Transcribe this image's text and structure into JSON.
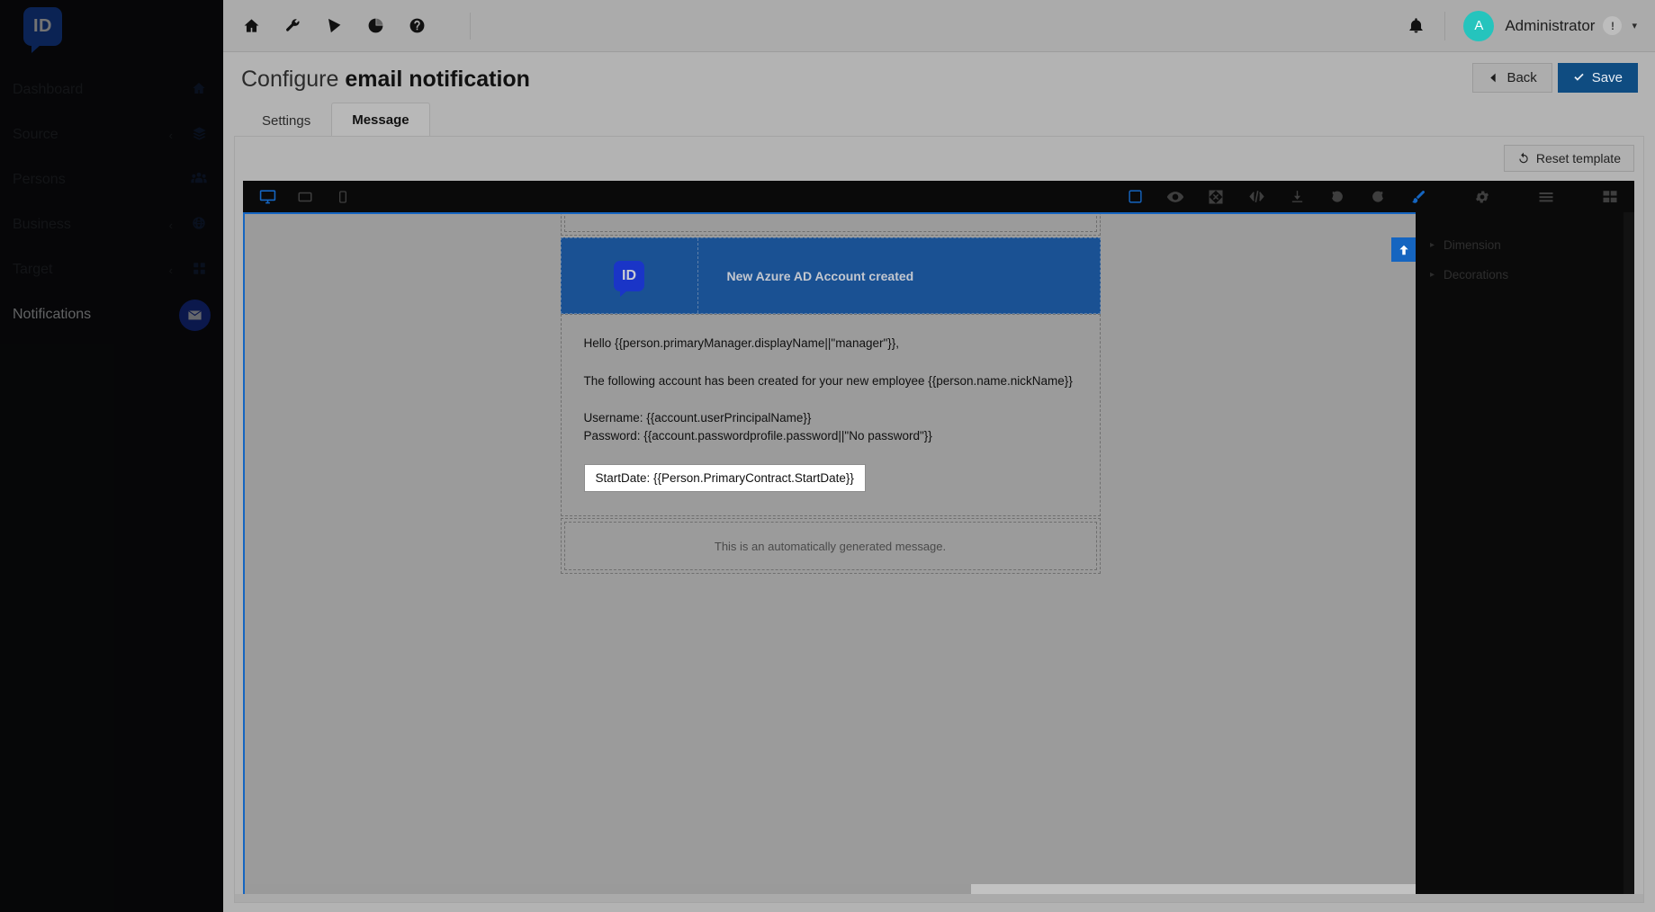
{
  "app": {
    "logo_text": "ID",
    "brand_blue": "#1a4fbb"
  },
  "sidebar": {
    "items": [
      {
        "label": "Dashboard",
        "icon": "home-icon",
        "caret": "",
        "active": false
      },
      {
        "label": "Source",
        "icon": "layers-icon",
        "caret": "‹",
        "active": false
      },
      {
        "label": "Persons",
        "icon": "users-icon",
        "caret": "",
        "active": false
      },
      {
        "label": "Business",
        "icon": "globe-icon",
        "caret": "‹",
        "active": false
      },
      {
        "label": "Target",
        "icon": "grid-icon",
        "caret": "‹",
        "active": false
      },
      {
        "label": "Notifications",
        "icon": "envelope-icon",
        "caret": "",
        "active": true
      }
    ]
  },
  "topbar": {
    "icons": [
      "home-icon",
      "wrench-icon",
      "project-diagram-icon",
      "pie-chart-icon",
      "question-circle-icon"
    ],
    "bell": "bell-icon",
    "avatar_initial": "A",
    "user_name": "Administrator",
    "user_badge": "!",
    "user_caret": "▾"
  },
  "page": {
    "title_prefix": "Configure ",
    "title_strong": "email notification",
    "back_label": "Back",
    "save_label": "Save",
    "reset_label": "Reset template"
  },
  "tabs": [
    {
      "label": "Settings",
      "active": false
    },
    {
      "label": "Message",
      "active": true
    }
  ],
  "editor": {
    "device_icons": [
      {
        "name": "desktop-icon",
        "active": true
      },
      {
        "name": "tablet-icon",
        "active": false
      },
      {
        "name": "mobile-icon",
        "active": false
      }
    ],
    "tool_icons": [
      {
        "name": "borders-toggle-icon",
        "active": true
      },
      {
        "name": "preview-eye-icon",
        "active": false
      },
      {
        "name": "fullscreen-icon",
        "active": false
      },
      {
        "name": "code-view-icon",
        "active": false
      },
      {
        "name": "import-download-icon",
        "active": false
      },
      {
        "name": "undo-icon",
        "active": false
      },
      {
        "name": "redo-icon",
        "active": false
      },
      {
        "name": "paint-brush-icon",
        "active": true
      },
      {
        "name": "gear-icon",
        "active": false
      },
      {
        "name": "layers-list-icon",
        "active": false
      },
      {
        "name": "blocks-grid-icon",
        "active": false
      }
    ],
    "move_up_icon": "arrow-up-icon"
  },
  "properties": {
    "sections": [
      {
        "label": "Dimension",
        "expanded": false
      },
      {
        "label": "Decorations",
        "expanded": false
      }
    ]
  },
  "email_template": {
    "logo_text": "ID",
    "header_title": "New Azure AD Account created",
    "body_lines": [
      "Hello {{person.primaryManager.displayName||\"manager\"}},",
      "The following account has been created for your new employee {{person.name.nickName}}",
      "Username: {{account.userPrincipalName}}",
      "Password: {{account.passwordprofile.password||\"No password\"}}"
    ],
    "selected_line": "StartDate: {{Person.PrimaryContract.StartDate}}",
    "footer_text": "This is an automatically generated message."
  }
}
